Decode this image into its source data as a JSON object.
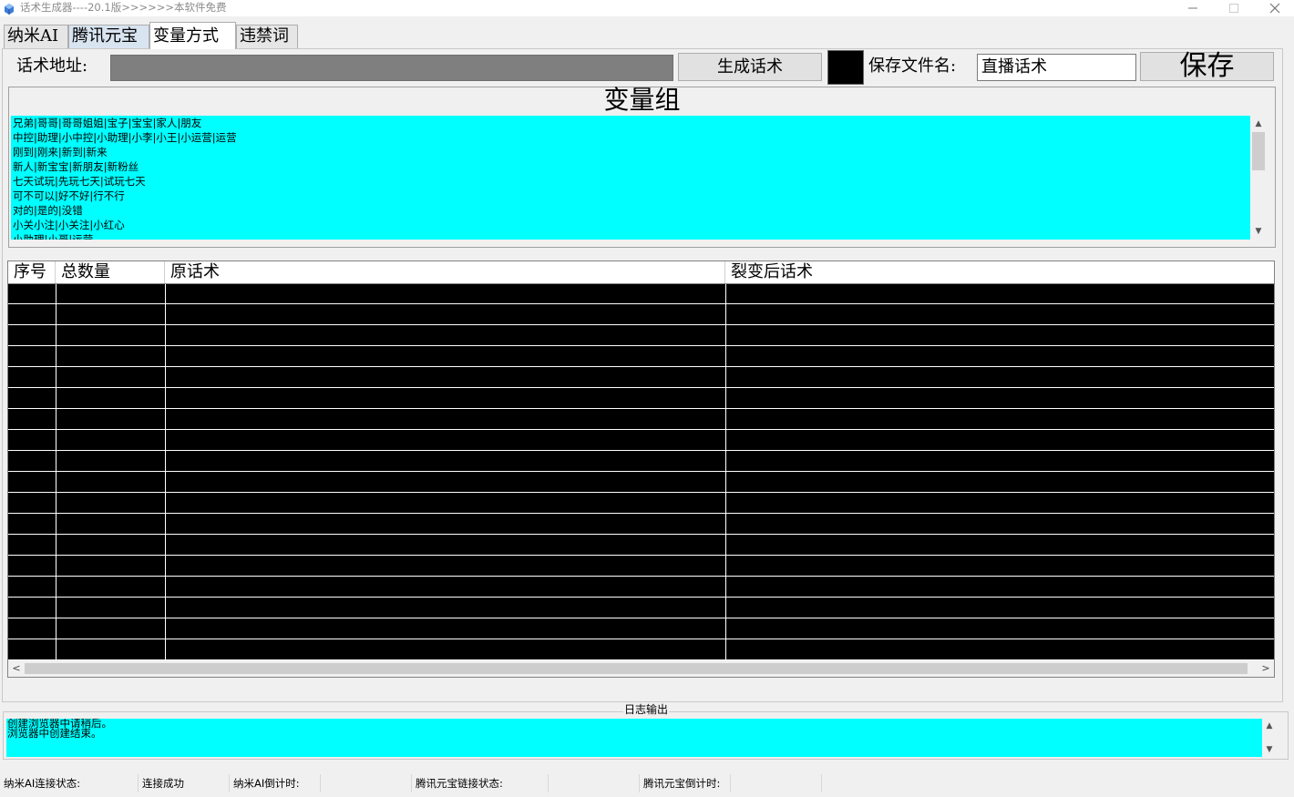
{
  "window": {
    "title": "话术生成器----20.1版>>>>>>本软件免费"
  },
  "tabs": [
    {
      "label": "纳米AI"
    },
    {
      "label": "腾讯元宝"
    },
    {
      "label": "变量方式"
    },
    {
      "label": "违禁词"
    }
  ],
  "toolbar": {
    "address_label": "话术地址:",
    "address_value": "",
    "generate_button": "生成话术",
    "color_swatch": "#000000",
    "save_filename_label": "保存文件名:",
    "save_filename_value": "直播话术",
    "save_button": "保存"
  },
  "variable_group": {
    "title": "变量组",
    "lines": [
      "兄弟|哥哥|哥哥姐姐|宝子|宝宝|家人|朋友",
      "中控|助理|小中控|小助理|小李|小王|小运营|运营",
      "刚到|刚来|新到|新来",
      "新人|新宝宝|新朋友|新粉丝",
      "七天试玩|先玩七天|试玩七天",
      "可不可以|好不好|行不行",
      "对的|是的|没错",
      "小关小注|小关注|小红心",
      "小助理|小哥|运营"
    ]
  },
  "table": {
    "columns": [
      "序号",
      "总数量",
      "原话术",
      "裂变后话术"
    ],
    "row_count": 18
  },
  "log": {
    "label": "日志输出",
    "lines": [
      "创建浏览器中请稍后。",
      "浏览器中创建结束。"
    ]
  },
  "status_bar": [
    "纳米AI连接状态:",
    "连接成功",
    "纳米AI倒计时:",
    "",
    "腾讯元宝链接状态:",
    "",
    "腾讯元宝倒计时:",
    ""
  ],
  "colors": {
    "cyan": "#00ffff",
    "table_bg": "#000000",
    "address_field": "#7f7f7f"
  }
}
